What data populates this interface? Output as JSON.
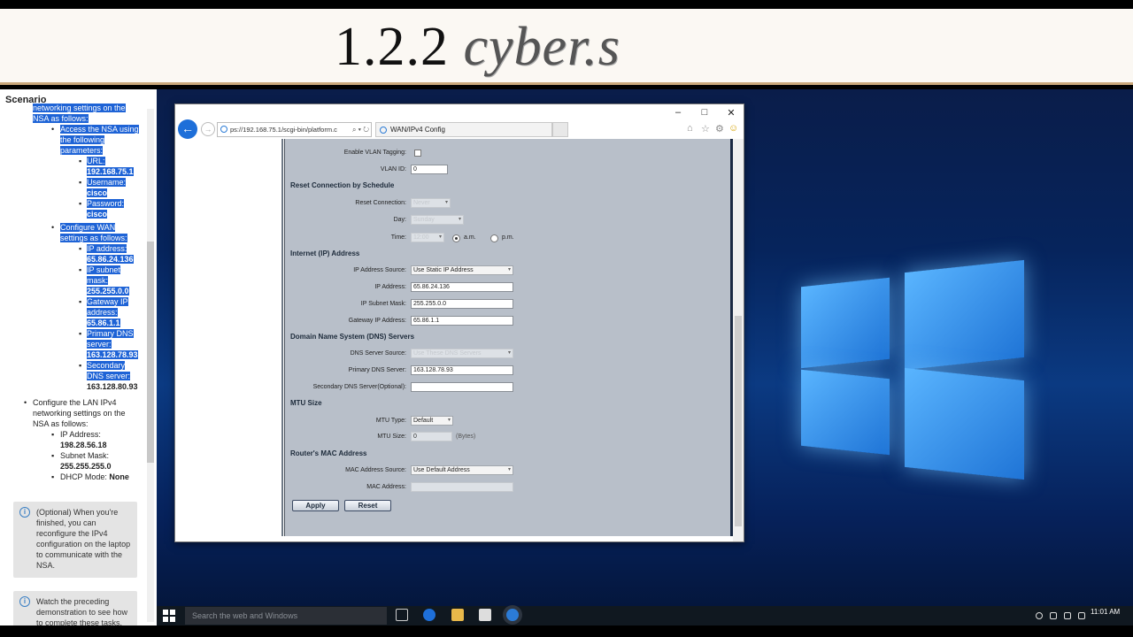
{
  "banner": {
    "title_prefix": "1.2.2",
    "title_sketch": "cyber.s"
  },
  "scenario": {
    "title": "Scenario",
    "lines": {
      "l1": "networking settings on the",
      "l2": "NSA as follows:",
      "access1": "Access the NSA using",
      "access2": "the following",
      "access3": "parameters:",
      "url_label": "URL:",
      "url_value": "192.168.75.1",
      "user_label": "Username:",
      "user_value": "cisco",
      "pass_label": "Password:",
      "pass_value": "cisco",
      "wan1": "Configure WAN",
      "wan2": "settings as follows:",
      "ip_label": "IP address:",
      "ip_value": "65.86.24.136",
      "mask_label1": "IP subnet",
      "mask_label2": "mask:",
      "mask_value": "255.255.0.0",
      "gw_label1": "Gateway IP",
      "gw_label2": "address:",
      "gw_value": "65.86.1.1",
      "pdns_label1": "Primary DNS",
      "pdns_label2": "server:",
      "pdns_value": "163.128.78.93",
      "sdns_label1": "Secondary",
      "sdns_label2": "DNS server:",
      "sdns_value": "163.128.80.93",
      "lan1": "Configure the LAN IPv4",
      "lan2": "networking settings on the",
      "lan3": "NSA as follows:",
      "lan_ip_label": "IP Address:",
      "lan_ip_value": "198.28.56.18",
      "lan_mask_label": "Subnet Mask:",
      "lan_mask_value": "255.255.255.0",
      "dhcp_label": "DHCP Mode:",
      "dhcp_value": "None"
    },
    "note1": "(Optional) When you're finished, you can reconfigure the IPv4 configuration on the laptop to communicate with the NSA.",
    "note2": "Watch the preceding demonstration to see how to complete these tasks."
  },
  "browser": {
    "address": "ps://192.168.75.1/scgi-bin/platform.c",
    "address_tools": "⌕ ▾ ↻",
    "tab_title": "WAN/IPv4 Config",
    "controls": {
      "minimize": "–",
      "maximize": "□",
      "close": "✕"
    }
  },
  "form": {
    "enable_vlan_label": "Enable VLAN Tagging:",
    "vlan_id_label": "VLAN ID:",
    "vlan_id_value": "0",
    "reset_section": "Reset Connection by Schedule",
    "reset_conn_label": "Reset Connection:",
    "reset_conn_value": "Never",
    "day_label": "Day:",
    "day_value": "Sunday",
    "time_label": "Time:",
    "time_value": "12:00",
    "am_label": "a.m.",
    "pm_label": "p.m.",
    "internet_section": "Internet (IP) Address",
    "ip_source_label": "IP Address Source:",
    "ip_source_value": "Use Static IP Address",
    "ip_label": "IP Address:",
    "ip_value": "65.86.24.136",
    "mask_label": "IP Subnet Mask:",
    "mask_value": "255.255.0.0",
    "gw_label": "Gateway IP Address:",
    "gw_value": "65.86.1.1",
    "dns_section": "Domain Name System (DNS) Servers",
    "dns_source_label": "DNS Server Source:",
    "dns_source_value": "Use These DNS Servers",
    "pdns_label": "Primary DNS Server:",
    "pdns_value": "163.128.78.93",
    "sdns_label": "Secondary DNS Server(Optional):",
    "sdns_value": "",
    "mtu_section": "MTU Size",
    "mtu_type_label": "MTU Type:",
    "mtu_type_value": "Default",
    "mtu_size_label": "MTU Size:",
    "mtu_size_value": "0",
    "mtu_unit": "(Bytes)",
    "mac_section": "Router's MAC Address",
    "mac_source_label": "MAC Address Source:",
    "mac_source_value": "Use Default Address",
    "mac_label": "MAC Address:",
    "mac_value": "",
    "apply_label": "Apply",
    "reset_label": "Reset"
  },
  "taskbar": {
    "search_placeholder": "Search the web and Windows",
    "time": "11:01 AM"
  },
  "colors": {
    "selection": "#1e63d6",
    "form_bg": "#b8bfc9",
    "accent": "#1e6fd9"
  }
}
